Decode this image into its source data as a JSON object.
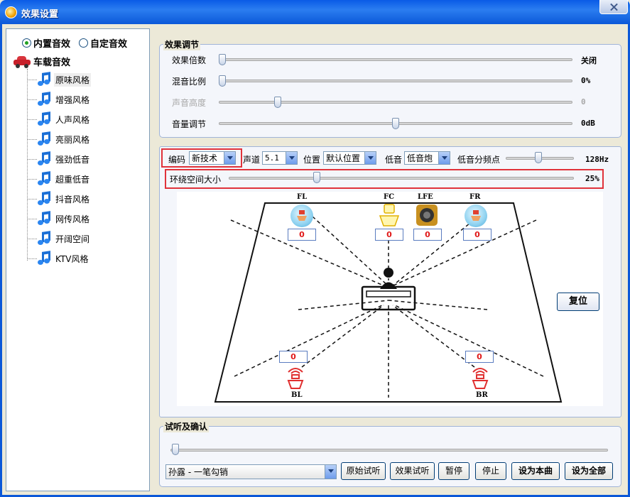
{
  "window": {
    "title": "效果设置"
  },
  "left": {
    "radio_builtin": "内置音效",
    "radio_custom": "自定音效",
    "category": "车载音效",
    "items": [
      "原味风格",
      "增强风格",
      "人声风格",
      "亮丽风格",
      "强劲低音",
      "超重低音",
      "抖音风格",
      "网传风格",
      "开阔空间",
      "KTV风格"
    ],
    "selected_index": 0
  },
  "effect": {
    "title": "效果调节",
    "sliders": [
      {
        "label": "效果倍数",
        "value": "关闭",
        "level": 0,
        "enabled": true
      },
      {
        "label": "混音比例",
        "value": "0%",
        "level": 0,
        "enabled": true
      },
      {
        "label": "声音高度",
        "value": "0",
        "level": 0.16,
        "enabled": false
      },
      {
        "label": "音量调节",
        "value": "0dB",
        "level": 0.5,
        "enabled": true
      }
    ]
  },
  "config": {
    "encode_label": "编码",
    "encode_value": "新技术",
    "channel_label": "声道",
    "channel_value": "5.1",
    "position_label": "位置",
    "position_value": "默认位置",
    "bass_label": "低音",
    "bass_value": "低音炮",
    "crossover_label": "低音分频点",
    "crossover_value": "128Hz",
    "crossover_level": 0.5,
    "surround_label": "环绕空间大小",
    "surround_value": "25%",
    "surround_level": 0.25
  },
  "speakers": {
    "FL": {
      "label": "FL",
      "value": "0"
    },
    "FC": {
      "label": "FC",
      "value": "0"
    },
    "LFE": {
      "label": "LFE",
      "value": "0"
    },
    "FR": {
      "label": "FR",
      "value": "0"
    },
    "BL": {
      "label": "BL",
      "value": "0"
    },
    "BR": {
      "label": "BR",
      "value": "0"
    }
  },
  "reset_label": "复位",
  "audition": {
    "title": "试听及确认",
    "progress": 0,
    "song": "孙露 - 一笔勾销",
    "buttons": [
      "原始试听",
      "效果试听",
      "暂停",
      "停止",
      "设为本曲",
      "设为全部"
    ]
  },
  "colors": {
    "accent": "#0b58d8",
    "highlight": "#e0323a",
    "value_red": "#e01818"
  }
}
